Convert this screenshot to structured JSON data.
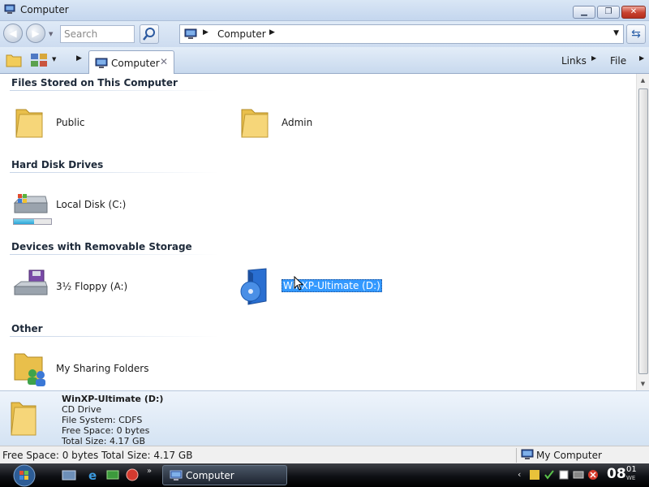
{
  "window": {
    "title": "Computer"
  },
  "nav": {
    "search_placeholder": "Search",
    "address_crumb": "Computer"
  },
  "toolbar": {
    "tab_label": "Computer",
    "tab_close": "✕",
    "links_label": "Links",
    "file_label": "File"
  },
  "groups": [
    {
      "header": "Files Stored on This Computer",
      "items": [
        {
          "label": "Public"
        },
        {
          "label": "Admin"
        }
      ]
    },
    {
      "header": "Hard Disk Drives",
      "items": [
        {
          "label": "Local Disk (C:)",
          "usage_fraction": 0.55
        }
      ]
    },
    {
      "header": "Devices with Removable Storage",
      "items": [
        {
          "label": "3½ Floppy (A:)"
        },
        {
          "label": "WinXP-Ultimate (D:)",
          "selected": true
        }
      ]
    },
    {
      "header": "Other",
      "items": [
        {
          "label": "My Sharing Folders"
        }
      ]
    }
  ],
  "details": {
    "name": "WinXP-Ultimate (D:)",
    "type": "CD Drive",
    "file_system": "File System: CDFS",
    "free_space": "Free Space: 0 bytes",
    "total_size": "Total Size: 4.17 GB"
  },
  "status": {
    "left": "Free Space: 0 bytes Total Size: 4.17 GB",
    "right": "My Computer"
  },
  "taskbar": {
    "task_label": "Computer",
    "clock_hour": "08",
    "clock_minute": "01",
    "clock_day": "WE"
  },
  "colors": {
    "selection": "#3399ff",
    "taskbar": "#0e1014",
    "accent": "#2aa5d8"
  }
}
